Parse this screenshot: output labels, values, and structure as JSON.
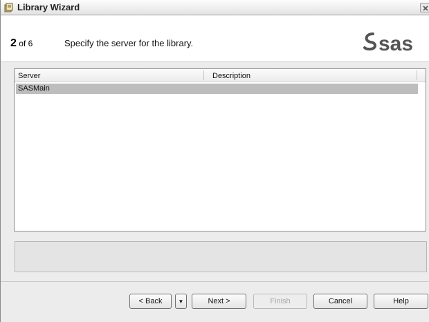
{
  "window": {
    "title": "Library Wizard",
    "icons": {
      "title": "library-wizard-icon",
      "close": "close-icon"
    }
  },
  "header": {
    "step_current": "2",
    "step_of": "of 6",
    "description": "Specify the server for the library.",
    "logo": "sas"
  },
  "list": {
    "columns": [
      "Server",
      "Description"
    ],
    "rows": [
      {
        "server": "SASMain",
        "description": "",
        "selected": true
      }
    ]
  },
  "buttons": {
    "back": "< Back",
    "back_menu_icon": "dropdown-arrow-icon",
    "next": "Next >",
    "finish": "Finish",
    "cancel": "Cancel",
    "help": "Help"
  },
  "colors": {
    "selection": "#bdbdbd",
    "logo_gray": "#555555"
  }
}
